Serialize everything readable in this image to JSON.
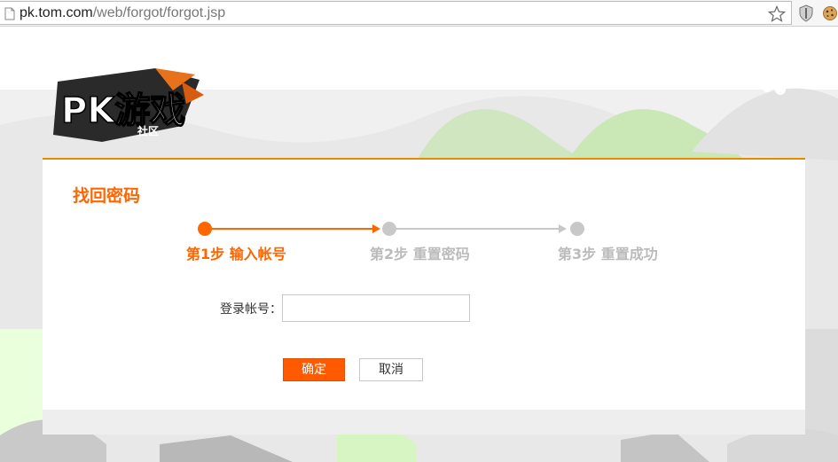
{
  "browser": {
    "url_host": "pk.tom.com",
    "url_path": "/web/forgot/forgot.jsp",
    "icons": [
      "page-icon",
      "star-icon",
      "shield-extension-icon",
      "cookie-extension-icon"
    ]
  },
  "logo": {
    "text": "PK游戏",
    "sub": "社区"
  },
  "form": {
    "title": "找回密码",
    "steps": [
      {
        "label": "第1步 输入帐号",
        "active": true
      },
      {
        "label": "第2步 重置密码",
        "active": false
      },
      {
        "label": "第3步 重置成功",
        "active": false
      }
    ],
    "account_label": "登录帐号：",
    "account_value": "",
    "confirm_label": "确定",
    "cancel_label": "取消"
  },
  "colors": {
    "accent": "#ff6600",
    "button": "#ff5a00",
    "inactive": "#bbbbbb",
    "card_border": "#e68a00"
  }
}
